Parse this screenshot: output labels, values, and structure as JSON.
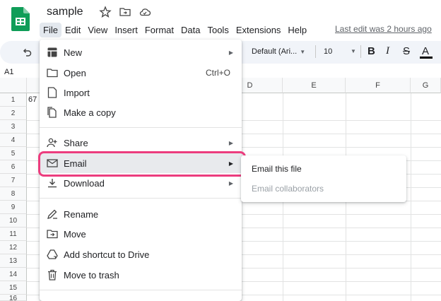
{
  "app": {
    "title": "sample",
    "last_edit": "Last edit was 2 hours ago"
  },
  "menubar": {
    "items": [
      "File",
      "Edit",
      "View",
      "Insert",
      "Format",
      "Data",
      "Tools",
      "Extensions",
      "Help"
    ]
  },
  "toolbar": {
    "font": "Default (Ari...",
    "font_size": "10",
    "bold": "B",
    "italic": "I",
    "strikethrough": "S",
    "text_color": "A"
  },
  "sheet": {
    "name_box": "A1",
    "columns": [
      "D",
      "E",
      "F",
      "G"
    ],
    "rows": [
      "1",
      "2",
      "3",
      "4",
      "5",
      "6",
      "7",
      "8",
      "9",
      "10",
      "11",
      "12",
      "13",
      "14",
      "15",
      "16"
    ],
    "cell_a1": "67"
  },
  "file_menu": {
    "items": [
      {
        "label": "New",
        "icon": "new-sheet-icon",
        "submenu": true
      },
      {
        "label": "Open",
        "icon": "folder-icon",
        "shortcut": "Ctrl+O"
      },
      {
        "label": "Import",
        "icon": "import-file-icon"
      },
      {
        "label": "Make a copy",
        "icon": "copy-icon"
      },
      {
        "label": "Share",
        "icon": "share-person-icon",
        "submenu": true
      },
      {
        "label": "Email",
        "icon": "mail-icon",
        "submenu": true,
        "highlighted": true
      },
      {
        "label": "Download",
        "icon": "download-icon",
        "submenu": true
      },
      {
        "label": "Rename",
        "icon": "rename-icon"
      },
      {
        "label": "Move",
        "icon": "move-folder-icon"
      },
      {
        "label": "Add shortcut to Drive",
        "icon": "drive-shortcut-icon"
      },
      {
        "label": "Move to trash",
        "icon": "trash-icon"
      }
    ]
  },
  "email_submenu": {
    "items": [
      {
        "label": "Email this file",
        "enabled": true
      },
      {
        "label": "Email collaborators",
        "enabled": false
      }
    ]
  },
  "colors": {
    "brand_green": "#0f9d58",
    "highlight": "#ec3d7e",
    "toolbar_bg": "#f1f4f9"
  }
}
